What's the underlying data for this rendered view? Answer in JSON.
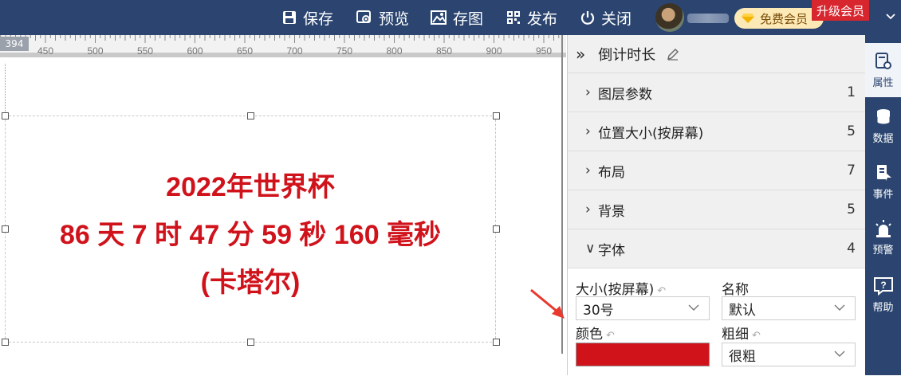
{
  "toolbar": {
    "save": "保存",
    "preview": "预览",
    "save_image": "存图",
    "publish": "发布",
    "close": "关闭",
    "free_member": "免费会员",
    "upgrade": "升级会员"
  },
  "ruler": {
    "position_marker": "394",
    "ticks": [
      "450",
      "500",
      "550",
      "600",
      "650",
      "700",
      "750",
      "800",
      "850",
      "900",
      "950"
    ]
  },
  "canvas": {
    "lines": [
      "2022年世界杯",
      "86 天 7 时 47 分 59 秒 160 毫秒",
      "(卡塔尔)"
    ],
    "text_color": "#d0121b"
  },
  "panel": {
    "title": "倒计时长",
    "sections": [
      {
        "label": "图层参数",
        "count": "1",
        "expanded": false
      },
      {
        "label": "位置大小(按屏幕)",
        "count": "5",
        "expanded": false
      },
      {
        "label": "布局",
        "count": "7",
        "expanded": false
      },
      {
        "label": "背景",
        "count": "5",
        "expanded": false
      },
      {
        "label": "字体",
        "count": "4",
        "expanded": true
      }
    ],
    "font": {
      "size_label": "大小(按屏幕)",
      "size_value": "30号",
      "name_label": "名称",
      "name_value": "默认",
      "color_label": "颜色",
      "color_value": "#d0121b",
      "weight_label": "粗细",
      "weight_value": "很粗"
    }
  },
  "iconbar": {
    "items": [
      "属性",
      "数据",
      "事件",
      "预警",
      "帮助"
    ]
  }
}
